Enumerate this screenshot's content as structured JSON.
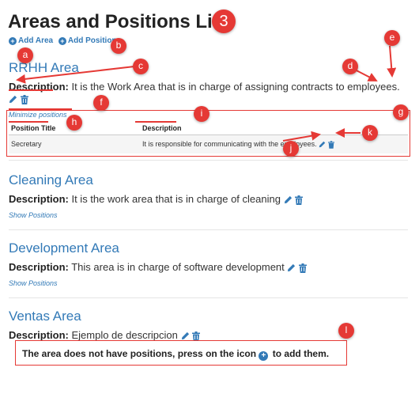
{
  "page": {
    "title": "Areas and Positions List",
    "step_number": "3"
  },
  "toolbar": {
    "add_area_label": "Add Area",
    "add_position_label": "Add Position"
  },
  "annotations": {
    "a": "a",
    "b": "b",
    "c": "c",
    "d": "d",
    "e": "e",
    "f": "f",
    "g": "g",
    "h": "h",
    "i": "i",
    "j": "j",
    "k": "k",
    "l": "l"
  },
  "areas": [
    {
      "title": "RRHH Area",
      "description_label": "Description:",
      "description": "It is the Work Area that is in charge of assigning contracts to employees.",
      "toggle_label": "Minimize positions",
      "positions": {
        "headers": [
          "Position Title",
          "Description"
        ],
        "rows": [
          {
            "title": "Secretary",
            "description": "It is responsible for communicating with the employees."
          }
        ]
      }
    },
    {
      "title": "Cleaning Area",
      "description_label": "Description:",
      "description": "It is the work area that is in charge of cleaning",
      "toggle_label": "Show Positions"
    },
    {
      "title": "Development Area",
      "description_label": "Description:",
      "description": "This area is in charge of software development",
      "toggle_label": "Show Positions"
    },
    {
      "title": "Ventas Area",
      "description_label": "Description:",
      "description": "Ejemplo de descripcion",
      "notice_before": "The area does not have positions, press on the icon",
      "notice_after": "to add them."
    }
  ],
  "colors": {
    "link": "#337ab7",
    "annotation": "#e53935",
    "text": "#333333"
  },
  "icons": [
    "plus-circle-icon",
    "pencil-icon",
    "trash-icon"
  ]
}
